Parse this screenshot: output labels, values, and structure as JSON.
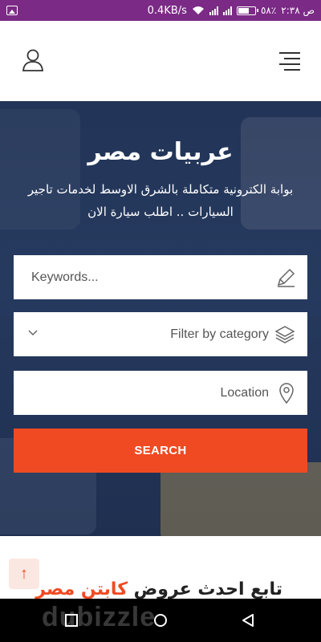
{
  "status_bar": {
    "speed": "0.4KB/s",
    "battery_percent": "٥٨٪",
    "time": "ص ٢:٣٨",
    "icons": [
      "image-icon",
      "wifi-icon",
      "signal-icon",
      "signal-icon",
      "battery-icon"
    ]
  },
  "header": {
    "icons": [
      "user-icon",
      "menu-icon"
    ]
  },
  "hero": {
    "title": "عربيات مصر",
    "subtitle": "بوابة الكترونية متكاملة بالشرق الاوسط لخدمات تاجير السيارات .. اطلب سيارة الان"
  },
  "search_form": {
    "keywords_placeholder": "Keywords...",
    "category_placeholder": "Filter by category",
    "location_placeholder": "Location",
    "search_label": "SEARCH"
  },
  "promo": {
    "text_dark": "تابع احدث عروض",
    "text_red": "كابتن مصر"
  },
  "watermark": "dubizzle",
  "colors": {
    "status_bar": "#7b2a86",
    "hero_bg": "#223457",
    "accent": "#f04a22"
  }
}
